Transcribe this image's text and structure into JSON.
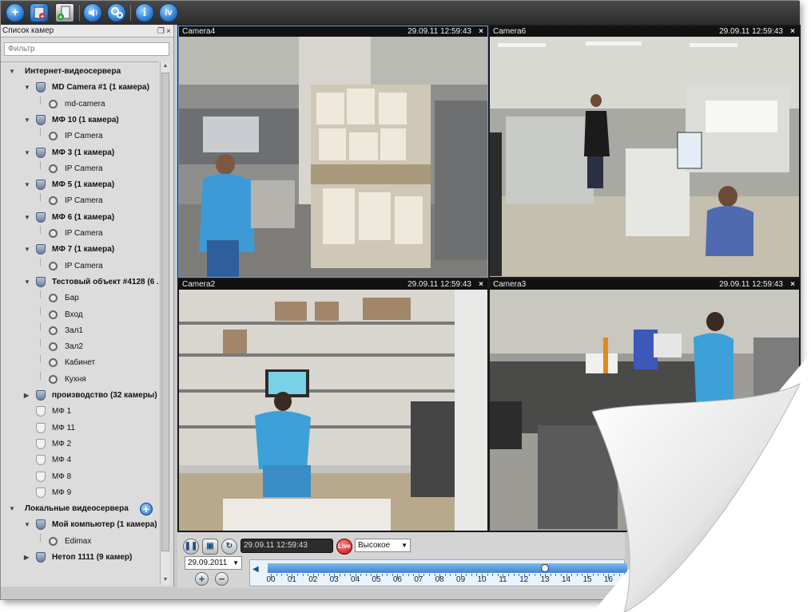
{
  "toolbar": {
    "buttons": [
      "add-icon",
      "add-server-icon",
      "add-folder-icon",
      "volume-icon",
      "settings-icon",
      "info-icon",
      "about-icon"
    ],
    "info_glyph": "i",
    "about_glyph": "iv",
    "add_glyph": "+"
  },
  "sidebar": {
    "title": "Список камер",
    "filter_placeholder": "Фильтр",
    "internet_group": "Интернет-видеосервера",
    "local_group": "Локальные видеосервера",
    "items": [
      {
        "label": "MD Camera #1 (1 камера)",
        "type": "server",
        "level": 1,
        "bold": true
      },
      {
        "label": "md-camera",
        "type": "camera",
        "level": 2
      },
      {
        "label": "МФ 10 (1 камера)",
        "type": "server",
        "level": 1,
        "bold": true
      },
      {
        "label": "IP Camera",
        "type": "camera",
        "level": 2
      },
      {
        "label": "МФ 3 (1 камера)",
        "type": "server",
        "level": 1,
        "bold": true
      },
      {
        "label": "IP Camera",
        "type": "camera",
        "level": 2
      },
      {
        "label": "МФ 5 (1 камера)",
        "type": "server",
        "level": 1,
        "bold": true
      },
      {
        "label": "IP Camera",
        "type": "camera",
        "level": 2
      },
      {
        "label": "МФ 6 (1 камера)",
        "type": "server",
        "level": 1,
        "bold": true
      },
      {
        "label": "IP Camera",
        "type": "camera",
        "level": 2
      },
      {
        "label": "МФ 7 (1 камера)",
        "type": "server",
        "level": 1,
        "bold": true
      },
      {
        "label": "IP Camera",
        "type": "camera",
        "level": 2
      },
      {
        "label": "Тестовый объект #4128 (6 ...",
        "type": "server",
        "level": 1,
        "bold": true
      },
      {
        "label": "Бар",
        "type": "camera",
        "level": 2
      },
      {
        "label": "Вход",
        "type": "camera",
        "level": 2
      },
      {
        "label": "Зал1",
        "type": "camera",
        "level": 2
      },
      {
        "label": "Зал2",
        "type": "camera",
        "level": 2
      },
      {
        "label": "Кабинет",
        "type": "camera",
        "level": 2
      },
      {
        "label": "Кухня",
        "type": "camera",
        "level": 2
      },
      {
        "label": "производство (32 камеры)",
        "type": "server",
        "level": 1,
        "bold": true,
        "collapsed": true
      },
      {
        "label": "МФ 1",
        "type": "server-plain",
        "level": 1
      },
      {
        "label": "МФ 11",
        "type": "server-plain",
        "level": 1
      },
      {
        "label": "МФ 2",
        "type": "server-plain",
        "level": 1
      },
      {
        "label": "МФ 4",
        "type": "server-plain",
        "level": 1
      },
      {
        "label": "МФ 8",
        "type": "server-plain",
        "level": 1
      },
      {
        "label": "МФ 9",
        "type": "server-plain",
        "level": 1
      }
    ],
    "local_items": [
      {
        "label": "Мой компьютер (1 камера)",
        "type": "server",
        "level": 1,
        "bold": true
      },
      {
        "label": "Edimax",
        "type": "camera",
        "level": 2
      },
      {
        "label": "Нетоп 1111 (9 камер)",
        "type": "server",
        "level": 1,
        "bold": true,
        "collapsed": true
      }
    ]
  },
  "tiles": [
    {
      "name": "Camera4",
      "time": "29.09.11 12:59:43",
      "close": "×",
      "selected": true
    },
    {
      "name": "Camera6",
      "time": "29.09.11 12:59:43",
      "close": "×",
      "selected": false
    },
    {
      "name": "Camera2",
      "time": "29.09.11 12:59:43",
      "close": "×",
      "selected": false
    },
    {
      "name": "Camera3",
      "time": "29.09.11 12:59:43",
      "close": "×",
      "selected": false
    }
  ],
  "controls": {
    "current_time": "29.09.11 12:59:43",
    "live_label": "Live",
    "quality": "Высокое",
    "date": "29.09.2011",
    "zoom_in": "+",
    "zoom_out": "−",
    "timeline_hours": [
      "00",
      "01",
      "02",
      "03",
      "04",
      "05",
      "06",
      "07",
      "08",
      "09",
      "10",
      "11",
      "12",
      "13",
      "14",
      "15",
      "16"
    ],
    "timeline_position_hour": 13.0
  }
}
